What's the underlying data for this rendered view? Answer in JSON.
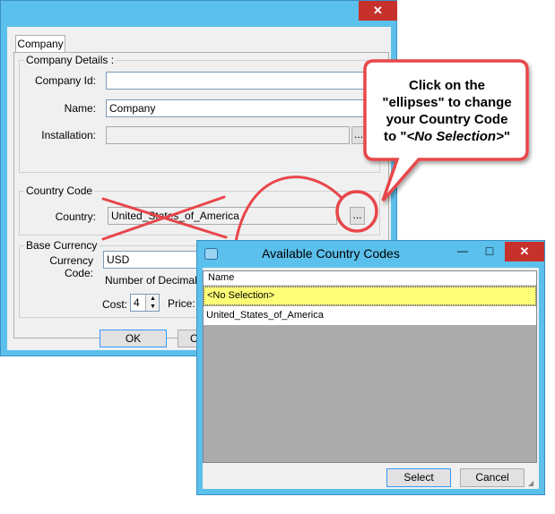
{
  "company_window": {
    "close_glyph": "✕",
    "tab_label": "Company",
    "details_group": {
      "legend": "Company Details :",
      "company_id_label": "Company Id:",
      "company_id_value": "",
      "name_label": "Name:",
      "name_value": "Company",
      "installation_label": "Installation:",
      "installation_value": "",
      "ellipsis_label": "..."
    },
    "country_group": {
      "legend": "Country Code",
      "country_label": "Country:",
      "country_value": "United_States_of_America",
      "ellipsis_label": "..."
    },
    "currency_group": {
      "legend": "Base Currency",
      "currency_code_label": "Currency Code:",
      "currency_code_value": "USD",
      "decimals_label": "Number of Decimals",
      "cost_label": "Cost:",
      "cost_value": "4",
      "price_label": "Price:"
    },
    "ok_label": "OK",
    "cancel_label_partial": "C"
  },
  "callout": {
    "line1": "Click on the",
    "line2": "\"ellipses\" to change",
    "line3": "your Country Code",
    "line4_prefix": "to \"",
    "line4_italic": "<No Selection>",
    "line4_suffix": "\""
  },
  "country_dialog": {
    "title": "Available Country Codes",
    "minimize_glyph": "—",
    "maximize_glyph": "□",
    "close_glyph": "✕",
    "column_header": "Name",
    "rows": [
      "<No Selection>",
      "United_States_of_America"
    ],
    "select_label": "Select",
    "cancel_label": "Cancel"
  },
  "colors": {
    "title_bar": "#5bc0eb",
    "close_button": "#c7312c",
    "annotation_red": "#e8464a",
    "highlight_row": "#ffff77"
  },
  "icons": [
    "close-icon",
    "minimize-icon",
    "maximize-icon",
    "window-app-icon",
    "spinner-up-icon",
    "spinner-down-icon",
    "size-grip-icon"
  ]
}
